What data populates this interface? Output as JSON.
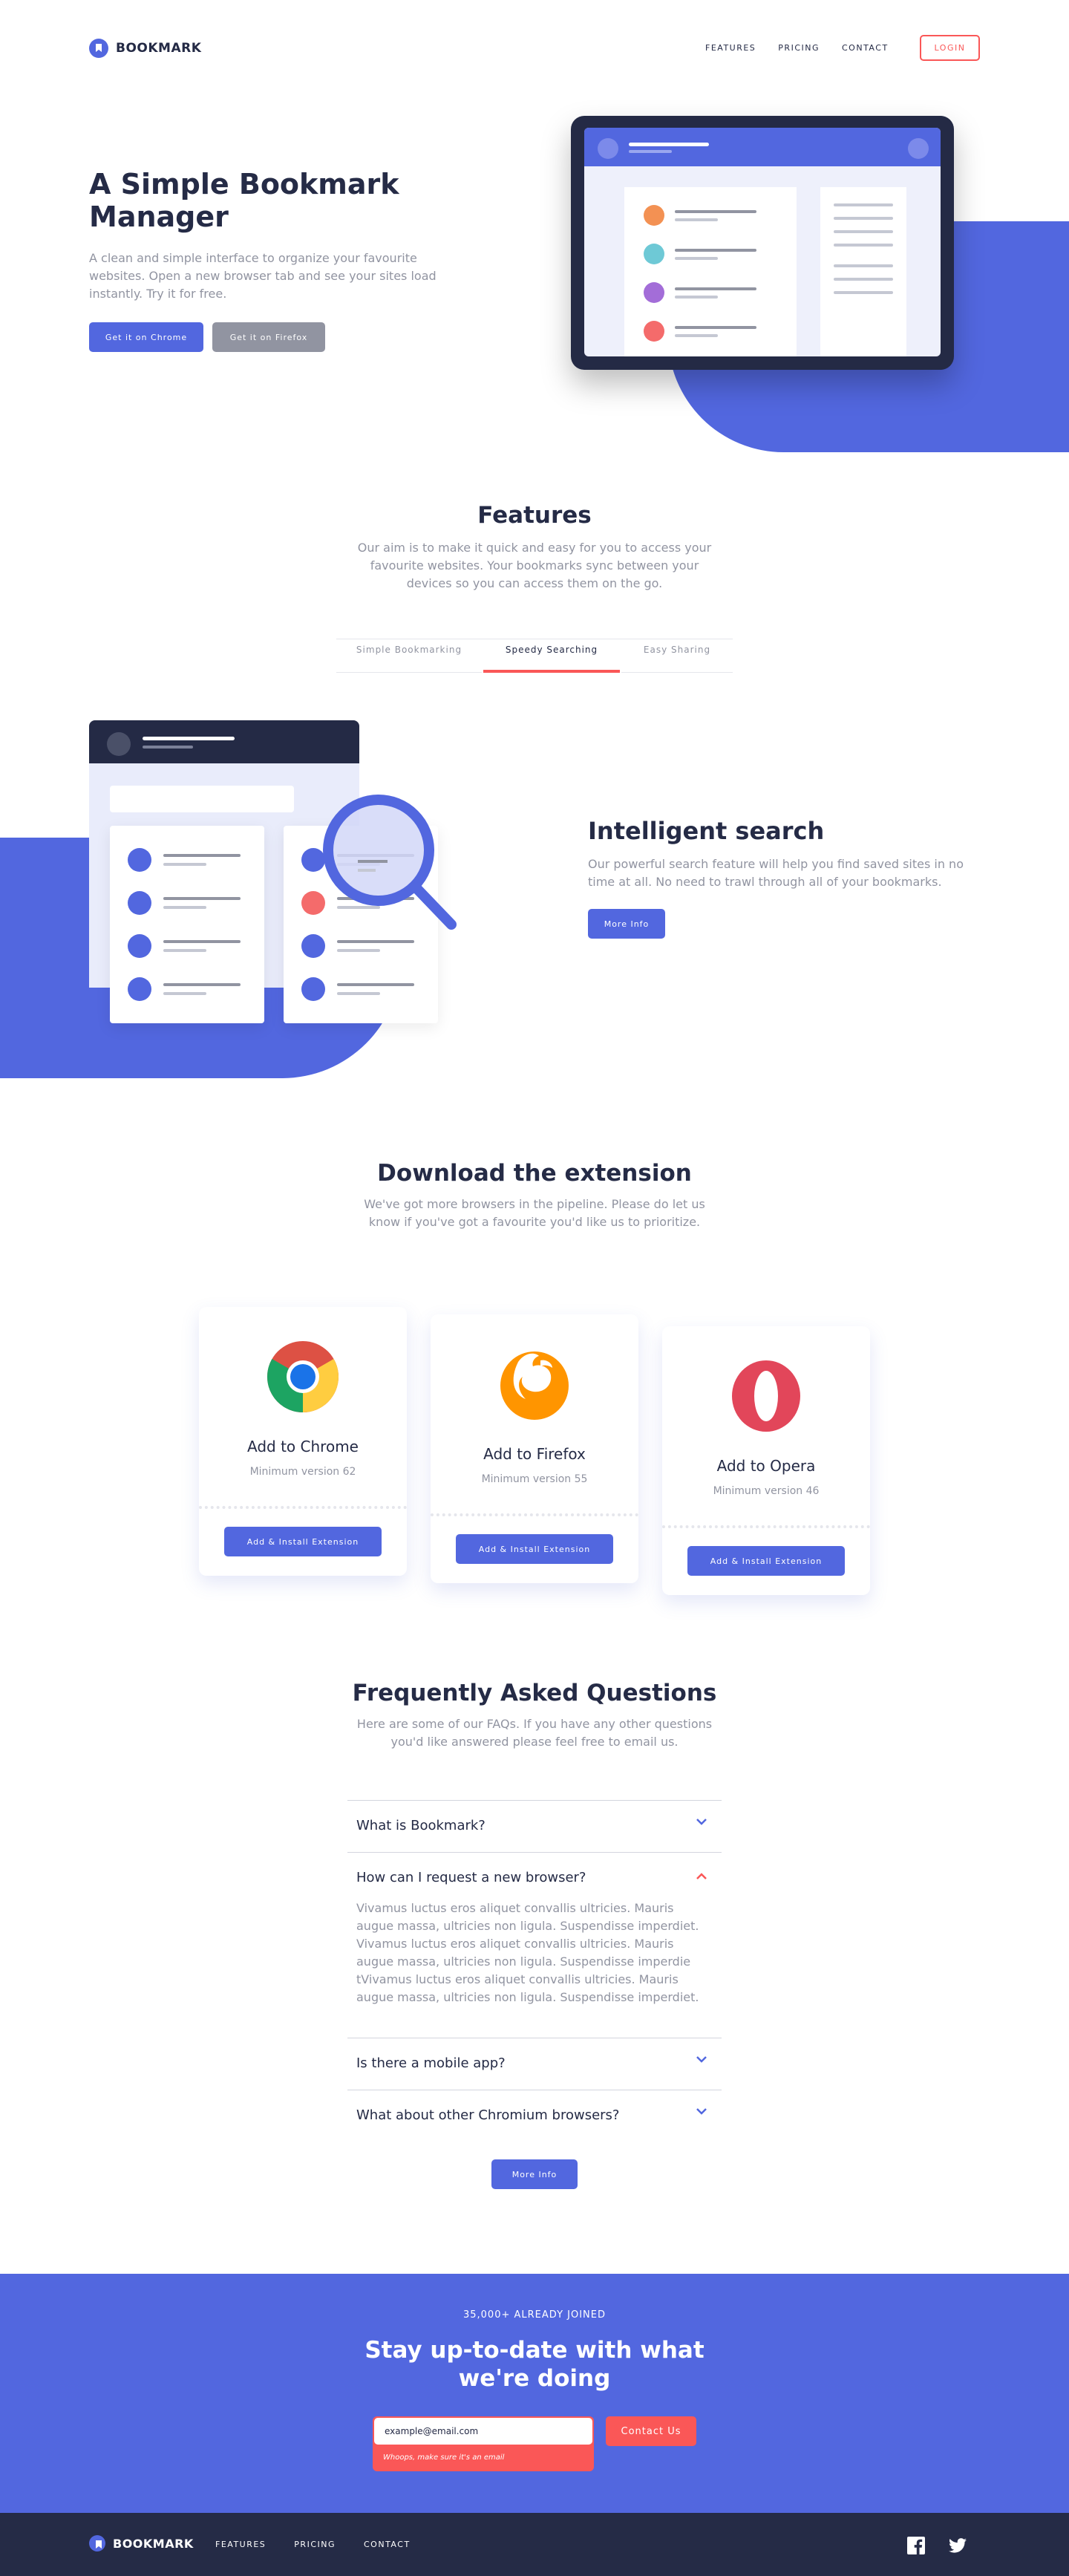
{
  "brand": {
    "name": "BOOKMARK",
    "accent": "#5267df",
    "red": "#fa5757",
    "dark": "#252b46"
  },
  "nav": {
    "links": [
      "FEATURES",
      "PRICING",
      "CONTACT"
    ],
    "login": "LOGIN"
  },
  "hero": {
    "title": "A Simple Bookmark Manager",
    "text": "A clean and simple interface to organize your favourite websites. Open a new browser tab and see your sites load instantly. Try it for free.",
    "chrome_button": "Get it on Chrome",
    "firefox_button": "Get it on Firefox"
  },
  "features": {
    "title": "Features",
    "text": "Our aim is to make it quick and easy for you to access your favourite websites. Your bookmarks sync between your devices so you can access them on the go.",
    "tabs": [
      {
        "label": "Simple Bookmarking",
        "active": false
      },
      {
        "label": "Speedy Searching",
        "active": true
      },
      {
        "label": "Easy Sharing",
        "active": false
      }
    ],
    "active_title": "Intelligent search",
    "active_text": "Our powerful search feature will help you find saved sites in no time at all. No need to trawl through all of your bookmarks.",
    "more_info": "More Info"
  },
  "download": {
    "title": "Download the extension",
    "text": "We've got more browsers in the pipeline. Please do let us know if you've got a favourite you'd like us to prioritize.",
    "cards": [
      {
        "title": "Add to Chrome",
        "version": "Minimum version 62",
        "button": "Add & Install Extension",
        "icon": "chrome-logo"
      },
      {
        "title": "Add to Firefox",
        "version": "Minimum version 55",
        "button": "Add & Install Extension",
        "icon": "firefox-logo"
      },
      {
        "title": "Add to Opera",
        "version": "Minimum version 46",
        "button": "Add & Install Extension",
        "icon": "opera-logo"
      }
    ]
  },
  "faq": {
    "title": "Frequently Asked Questions",
    "text": "Here are some of our FAQs. If you have any other questions you'd like answered please feel free to email us.",
    "items": [
      {
        "question": "What is Bookmark?",
        "open": false
      },
      {
        "question": "How can I request a new browser?",
        "open": true,
        "answer": "Vivamus luctus eros aliquet convallis ultricies. Mauris augue massa, ultricies non ligula. Suspendisse imperdiet. Vivamus luctus eros aliquet convallis ultricies. Mauris augue massa, ultricies non ligula. Suspendisse imperdie tVivamus luctus eros aliquet convallis ultricies. Mauris augue massa, ultricies non ligula. Suspendisse imperdiet."
      },
      {
        "question": "Is there a mobile app?",
        "open": false
      },
      {
        "question": "What about other Chromium browsers?",
        "open": false
      }
    ],
    "more_info": "More Info"
  },
  "newsletter": {
    "kicker": "35,000+ ALREADY JOINED",
    "title": "Stay up-to-date with what we're doing",
    "input_value": "example@email.com",
    "error": "Whoops, make sure it's an email",
    "button": "Contact Us"
  },
  "footer": {
    "brand": "BOOKMARK",
    "links": [
      "FEATURES",
      "PRICING",
      "CONTACT"
    ],
    "social": [
      "facebook-icon",
      "twitter-icon"
    ]
  }
}
